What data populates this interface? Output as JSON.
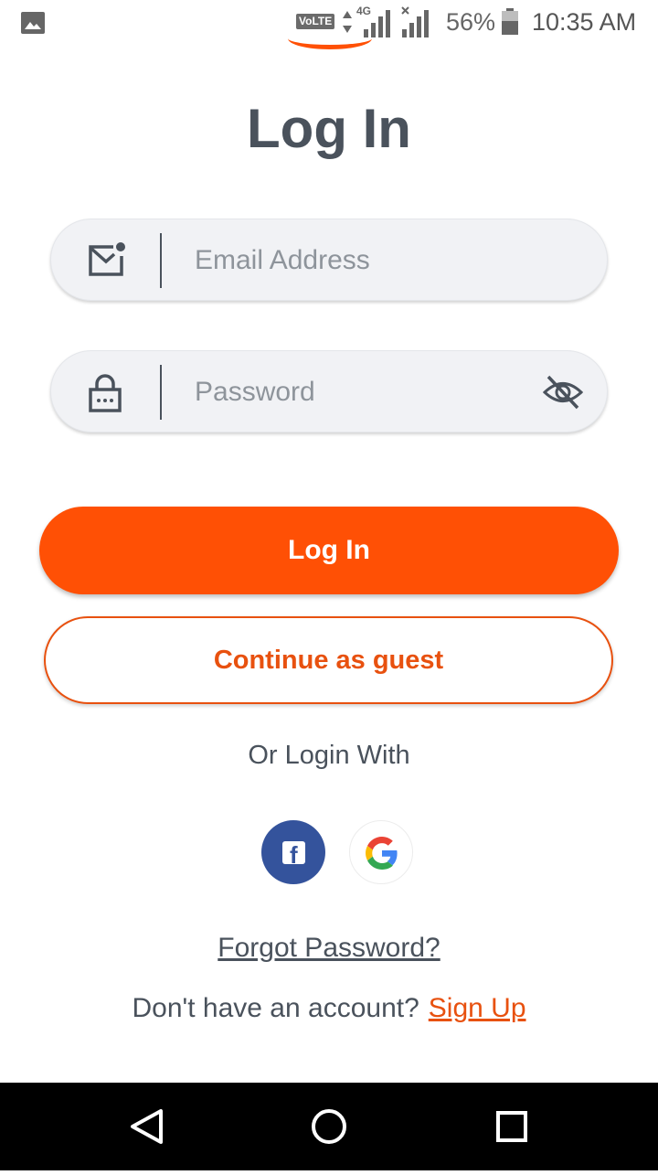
{
  "status_bar": {
    "volte_label": "VoLTE",
    "network_type": "4G",
    "battery_percent": "56%",
    "time": "10:35 AM"
  },
  "login": {
    "title": "Log In",
    "email_placeholder": "Email Address",
    "password_placeholder": "Password",
    "login_button_label": "Log In",
    "guest_button_label": "Continue as guest",
    "or_login_with": "Or Login With",
    "forgot_password": "Forgot Password?",
    "no_account_text": "Don't have an account?",
    "sign_up_link": "Sign Up"
  },
  "social_logins": [
    {
      "icon": "facebook-icon",
      "color": "#34539c"
    },
    {
      "icon": "google-icon",
      "color": "#ffffff"
    }
  ],
  "colors": {
    "accent": "#ff5005",
    "text_dark": "#4a525c",
    "field_bg": "#f1f2f5",
    "facebook": "#34539c"
  }
}
